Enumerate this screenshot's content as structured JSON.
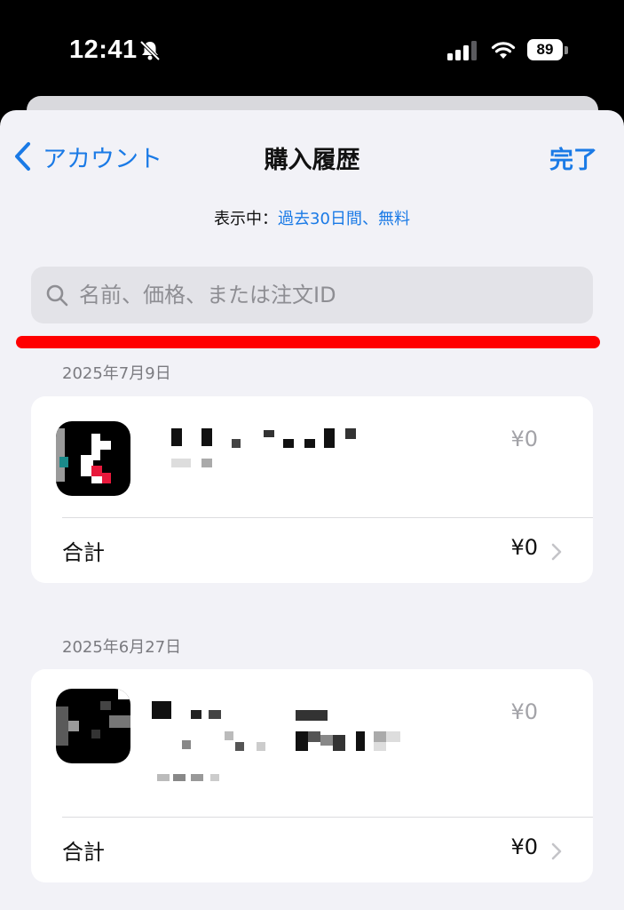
{
  "status": {
    "time": "12:41",
    "battery": "89"
  },
  "nav": {
    "back_label": "アカウント",
    "title": "購入履歴",
    "done_label": "完了"
  },
  "filter": {
    "label": "表示中：",
    "value": "過去30日間、無料"
  },
  "search": {
    "placeholder": "名前、価格、または注文ID"
  },
  "purchases": [
    {
      "date": "2025年7月9日",
      "price": "¥0",
      "total_label": "合計",
      "total_value": "¥0"
    },
    {
      "date": "2025年6月27日",
      "price": "¥0",
      "total_label": "合計",
      "total_value": "¥0"
    }
  ],
  "colors": {
    "accent": "#1a7ae6",
    "highlight": "#ff0000",
    "background": "#f2f2f7"
  }
}
